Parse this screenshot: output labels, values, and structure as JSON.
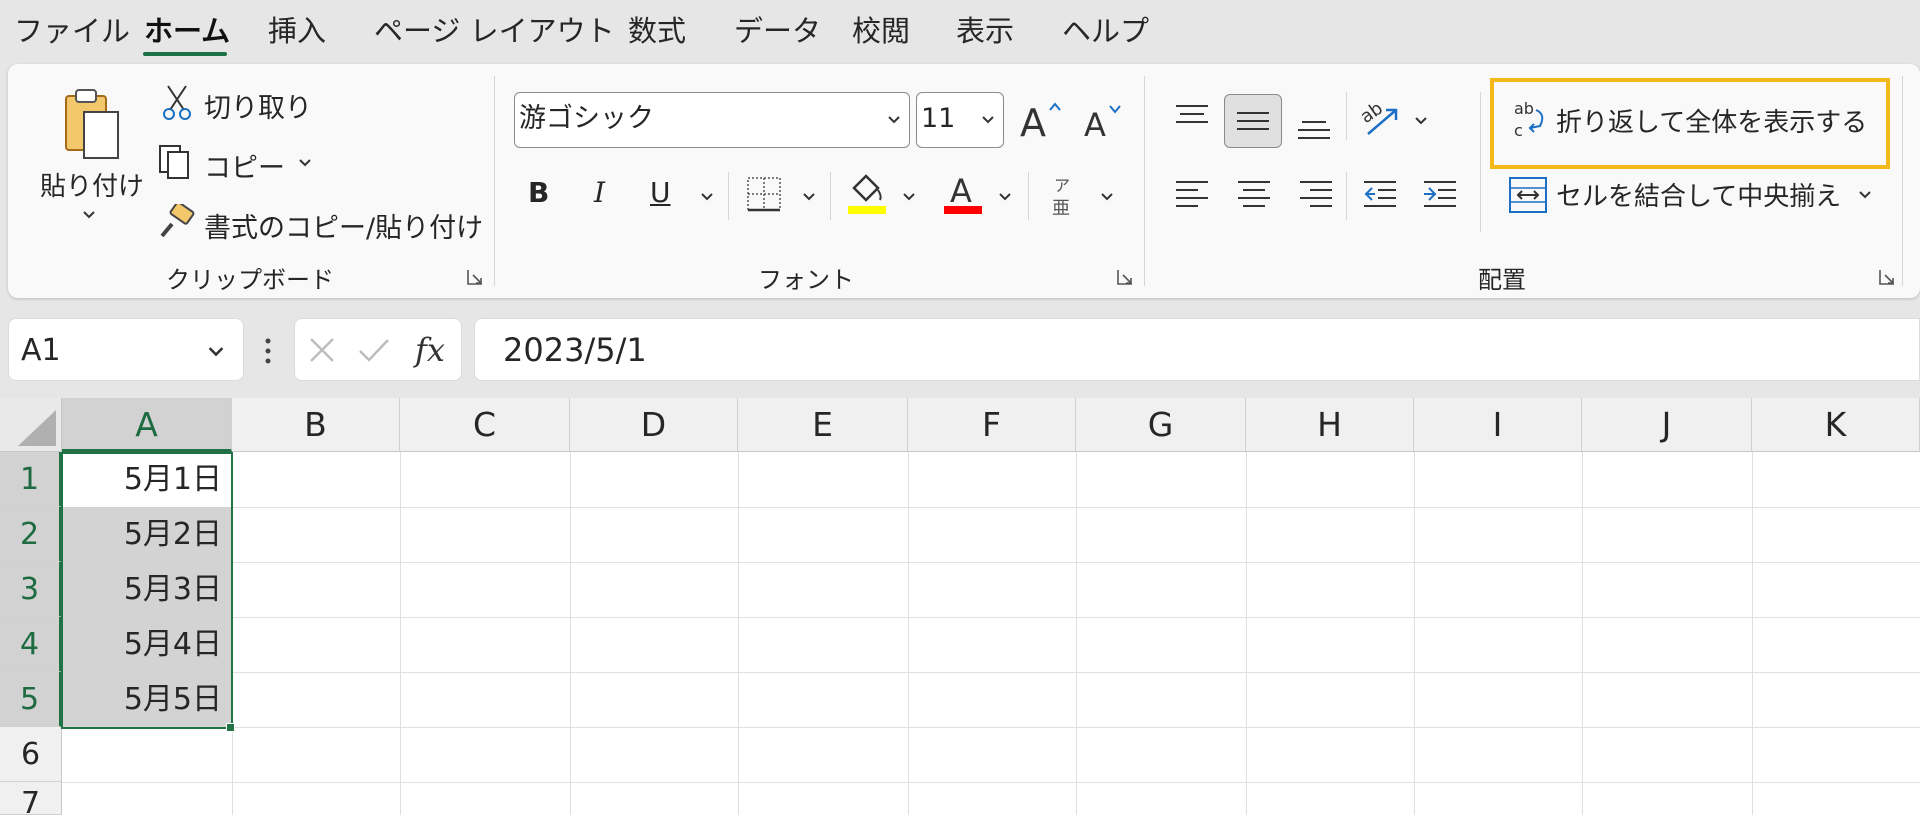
{
  "menu": {
    "tabs": [
      "ファイル",
      "ホーム",
      "挿入",
      "ページ レイアウト",
      "数式",
      "データ",
      "校閲",
      "表示",
      "ヘルプ"
    ],
    "active_tab": "ホーム"
  },
  "ribbon": {
    "clipboard": {
      "paste_label": "貼り付け",
      "cut_label": "切り取り",
      "copy_label": "コピー",
      "format_painter_label": "書式のコピー/貼り付け",
      "group_label": "クリップボード"
    },
    "font": {
      "font_name": "游ゴシック",
      "font_size": "11",
      "group_label": "フォント",
      "bold_label": "B",
      "italic_label": "I",
      "underline_label": "U",
      "fill_color": "#ffff00",
      "font_color": "#ff0000",
      "phonetic_top": "ア",
      "phonetic_bottom": "亜"
    },
    "alignment": {
      "wrap_text_label": "折り返して全体を表示する",
      "merge_center_label": "セルを結合して中央揃え",
      "group_label": "配置",
      "highlight_color": "#f4b919"
    }
  },
  "formula_bar": {
    "name_box": "A1",
    "formula": "2023/5/1"
  },
  "sheet": {
    "columns": [
      "A",
      "B",
      "C",
      "D",
      "E",
      "F",
      "G",
      "H",
      "I",
      "J",
      "K"
    ],
    "selected_column": "A",
    "rows": [
      "1",
      "2",
      "3",
      "4",
      "5",
      "6",
      "7"
    ],
    "cells_A": [
      "5月1日",
      "5月2日",
      "5月3日",
      "5月4日",
      "5月5日"
    ],
    "selection_color": "#217346"
  }
}
